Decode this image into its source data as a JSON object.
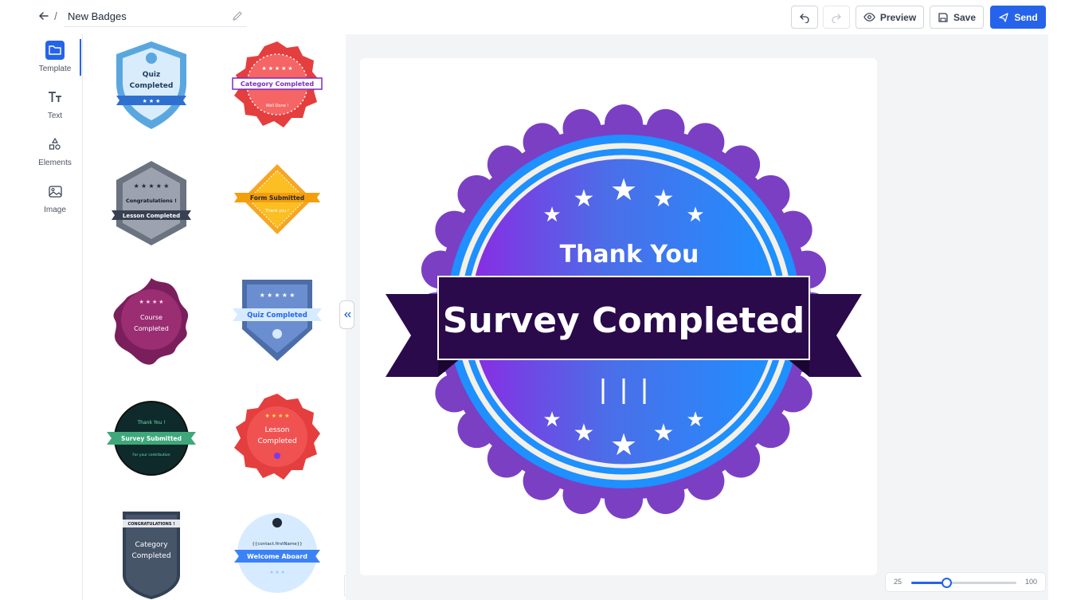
{
  "header": {
    "title": "New Badges",
    "preview_label": "Preview",
    "save_label": "Save",
    "send_label": "Send",
    "slash": "/"
  },
  "rail": {
    "items": [
      {
        "label": "Template",
        "icon": "folder-icon"
      },
      {
        "label": "Text",
        "icon": "text-icon"
      },
      {
        "label": "Elements",
        "icon": "shapes-icon"
      },
      {
        "label": "Image",
        "icon": "image-icon"
      }
    ]
  },
  "templates": [
    {
      "line1": "Quiz",
      "line2": "Completed"
    },
    {
      "line1": "Category Completed",
      "line2": "Well Done !"
    },
    {
      "line1": "Congratulations !",
      "line2": "Lesson Completed"
    },
    {
      "line1": "Form Submitted",
      "line2": "Thank you !"
    },
    {
      "line1": "Course",
      "line2": "Completed"
    },
    {
      "line1": "Quiz Completed",
      "line2": ""
    },
    {
      "line1": "Thank You !",
      "line2": "Survey Submitted",
      "line3": "For your contribution"
    },
    {
      "line1": "Lesson",
      "line2": "Completed"
    },
    {
      "line1": "CONGRATULATIONS !",
      "line2": "Category",
      "line3": "Completed"
    },
    {
      "line1": "{{contact.firstName}}",
      "line2": "Welcome Aboard"
    }
  ],
  "canvas_badge": {
    "top_text": "Thank You",
    "ribbon_text": "Survey Completed",
    "colors": {
      "outer": "#7b3fc4",
      "inner_start": "#8a2be2",
      "inner_end": "#1e90ff",
      "ribbon": "#2a0a4a"
    }
  },
  "zoom": {
    "min": "25",
    "max": "100",
    "value": 50
  }
}
